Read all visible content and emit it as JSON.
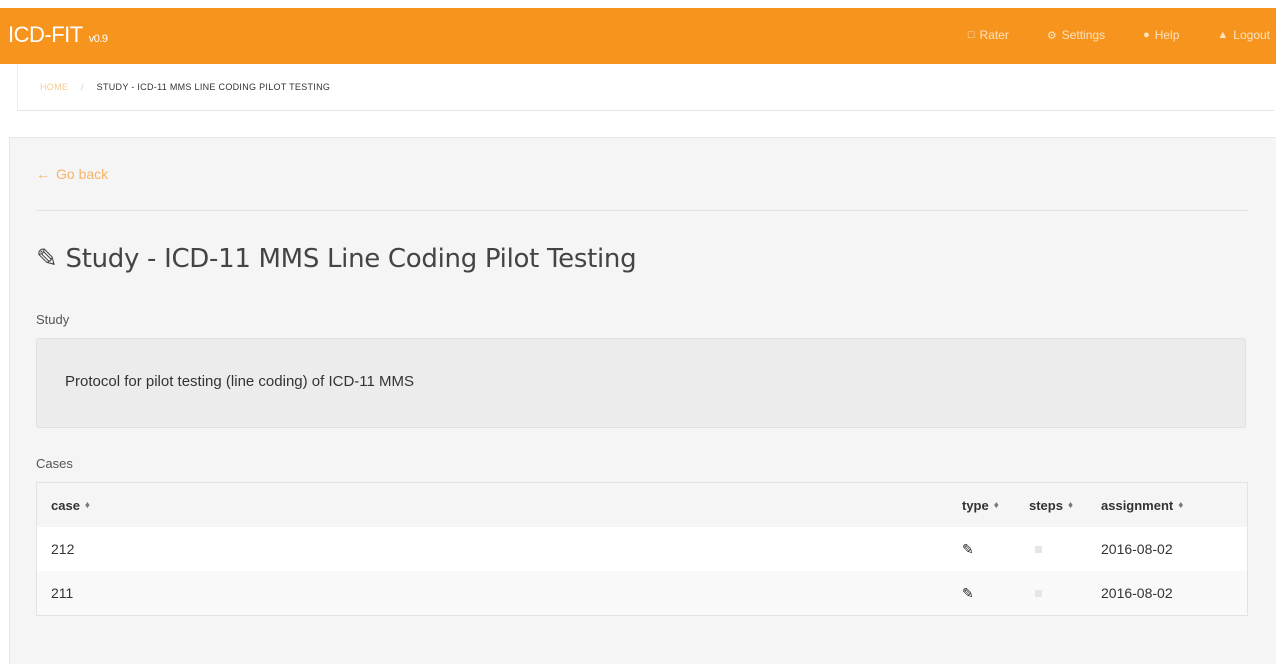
{
  "app": {
    "name": "ICD-FIT",
    "version": "v0.9"
  },
  "nav": [
    {
      "label": "Rater",
      "icon": "laptop-icon",
      "glyph": "💻"
    },
    {
      "label": "Settings",
      "icon": "gear-icon",
      "glyph": "⚙"
    },
    {
      "label": "Help",
      "icon": "help-icon",
      "glyph": "●"
    },
    {
      "label": "Logout",
      "icon": "lock-icon",
      "glyph": "▲"
    }
  ],
  "breadcrumb": {
    "home": "HOME",
    "separator": "/",
    "current": "STUDY - ICD-11 MMS LINE CODING PILOT TESTING"
  },
  "goback": {
    "label": "Go back",
    "glyph": "←"
  },
  "page": {
    "title": "Study - ICD-11 MMS Line Coding Pilot Testing",
    "title_glyph": "✎",
    "study_label": "Study",
    "study_text": "Protocol for pilot testing (line coding) of ICD-11 MMS",
    "cases_label": "Cases"
  },
  "table": {
    "headers": {
      "case": "case",
      "type": "type",
      "steps": "steps",
      "assignment": "assignment"
    },
    "sort_glyph": "♦",
    "type_glyph": "✎",
    "rows": [
      {
        "case": "212",
        "assignment": "2016-08-02"
      },
      {
        "case": "211",
        "assignment": "2016-08-02"
      }
    ]
  },
  "colors": {
    "brand": "#f7941e",
    "link": "#f7b367"
  }
}
